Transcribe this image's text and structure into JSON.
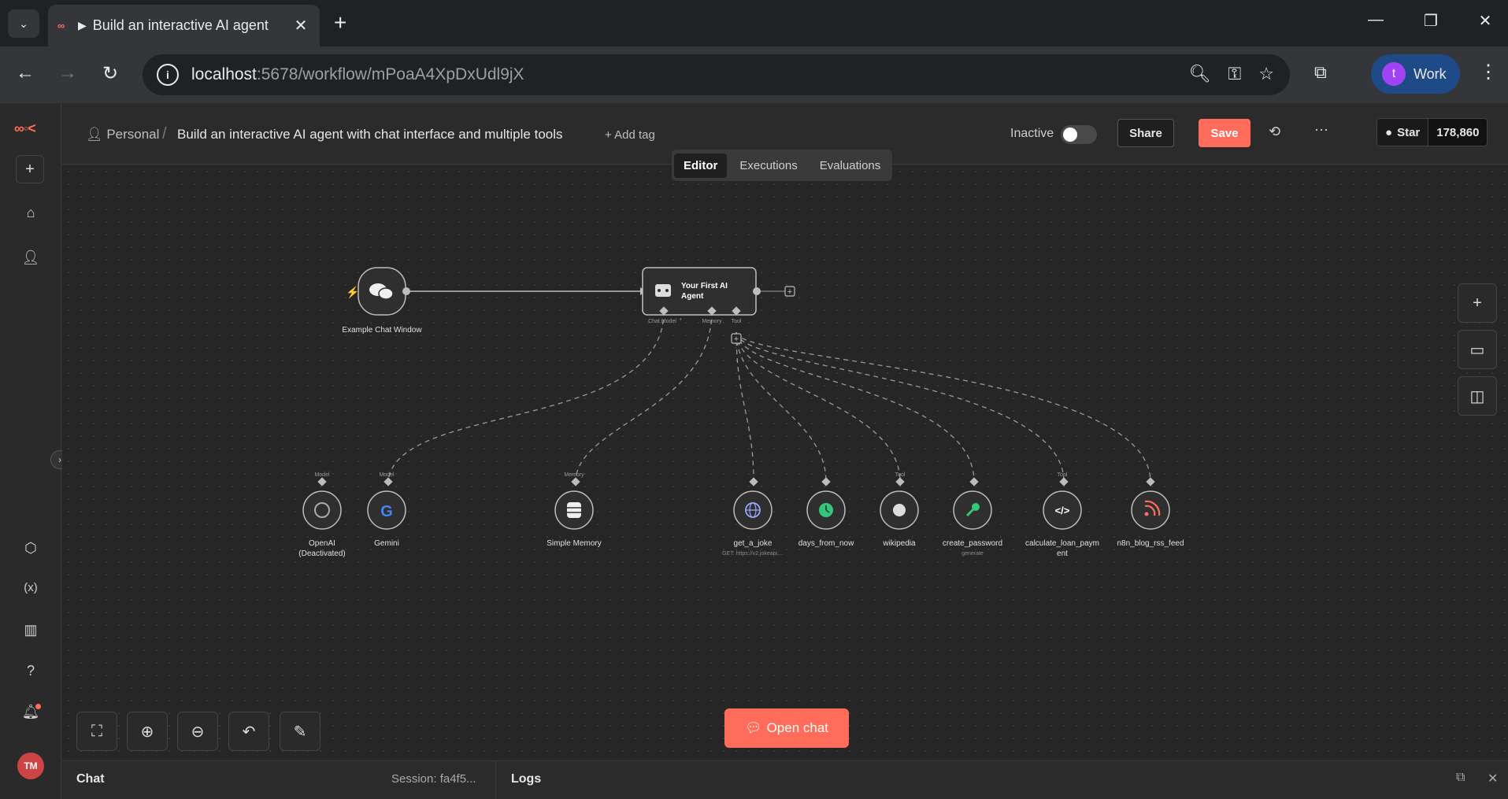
{
  "browser": {
    "tab_title": "Build an interactive AI agent",
    "url_host": "localhost",
    "url_path": ":5678/workflow/mPoaA4XpDxUdl9jX",
    "profile_initial": "t",
    "profile_label": "Work"
  },
  "header": {
    "breadcrumb_user": "Personal",
    "workflow_title": "Build an interactive AI agent with chat interface and multiple tools",
    "add_tag": "+ Add tag",
    "status_label": "Inactive",
    "share_label": "Share",
    "save_label": "Save",
    "github_star_label": "Star",
    "github_star_count": "178,860",
    "tabs": [
      "Editor",
      "Executions",
      "Evaluations"
    ]
  },
  "nodes": {
    "trigger": "Example Chat Window",
    "agent_line1": "Your First AI",
    "agent_line2": "Agent",
    "port_chat_model": "Chat Model",
    "port_memory": "Memory",
    "port_tool": "Tool",
    "openai_line1": "OpenAI",
    "openai_line2": "(Deactivated)",
    "openai_port": "Model",
    "gemini": "Gemini",
    "gemini_port": "Model",
    "memory": "Simple Memory",
    "memory_port": "Memory",
    "joke": "get_a_joke",
    "joke_sub": "GET: https://v2.jokeapi....",
    "days": "days_from_now",
    "wiki": "wikipedia",
    "wiki_port": "Tool",
    "password": "create_password",
    "password_sub": "generate",
    "loan_line1": "calculate_loan_paym",
    "loan_line2": "ent",
    "loan_port": "Tool",
    "rss": "n8n_blog_rss_feed"
  },
  "canvas": {
    "open_chat_label": "Open chat"
  },
  "bottom_panel": {
    "chat_label": "Chat",
    "session_label": "Session: fa4f5...",
    "logs_label": "Logs"
  },
  "sidebar": {
    "avatar_initials": "TM"
  },
  "colors": {
    "accent": "#ff6d5a",
    "canvas_bg": "#262626"
  }
}
